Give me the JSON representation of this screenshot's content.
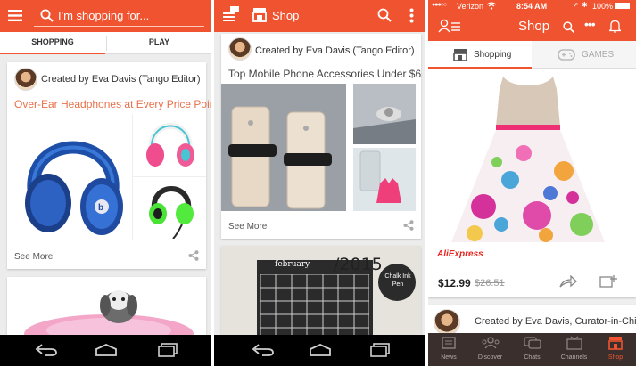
{
  "panel_play": {
    "search": {
      "placeholder": "I'm shopping for..."
    },
    "tabs": [
      {
        "label": "SHOPPING"
      },
      {
        "label": "PLAY"
      }
    ],
    "card1": {
      "author": "Created by Eva Davis (Tango Editor)",
      "title": "Over-Ear Headphones at Every Price Point",
      "see_more": "See More"
    }
  },
  "panel_shop_android": {
    "header": {
      "title": "Shop"
    },
    "card1": {
      "author": "Created by Eva Davis (Tango Editor)",
      "title": "Top Mobile Phone Accessories Under $6",
      "see_more": "See More"
    },
    "calendar": {
      "month": "february",
      "year": "/2015",
      "pen_text": "Chalk Ink Pen"
    }
  },
  "panel_shop_ios": {
    "status": {
      "carrier": "Verizon",
      "time": "8:54 AM",
      "battery": "100%"
    },
    "header": {
      "title": "Shop"
    },
    "tabs": [
      {
        "label": "Shopping"
      },
      {
        "label": "GAMES"
      }
    ],
    "product": {
      "brand": "AliExpress",
      "price": "$12.99",
      "old_price": "$26.51"
    },
    "card2": {
      "author": "Created by Eva Davis, Curator-in-Chief"
    },
    "bottom_tabs": [
      {
        "label": "News",
        "icon": "news-icon"
      },
      {
        "label": "Discover",
        "icon": "people-icon"
      },
      {
        "label": "Chats",
        "icon": "chats-icon"
      },
      {
        "label": "Channels",
        "icon": "tv-icon"
      },
      {
        "label": "Shop",
        "icon": "shop-icon"
      }
    ]
  },
  "colors": {
    "accent": "#f0532f",
    "title_orange": "#e9714b",
    "nav_black": "#000000",
    "tabbar_dark": "#3a2f2c"
  }
}
